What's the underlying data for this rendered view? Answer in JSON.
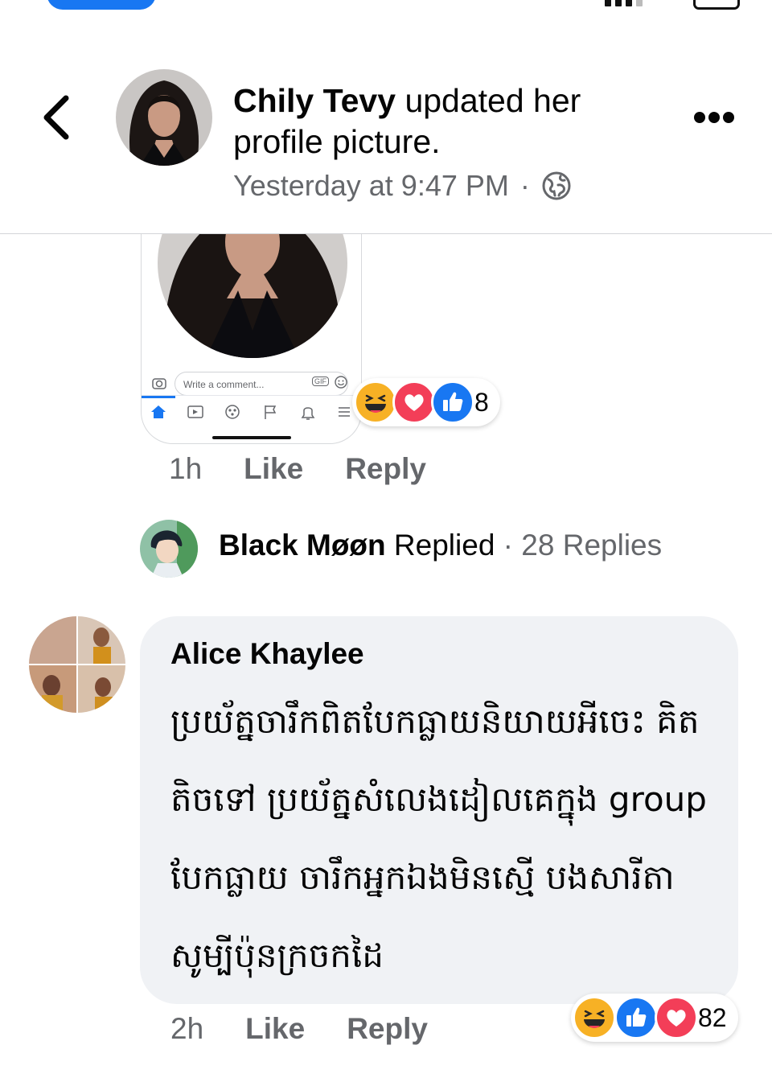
{
  "header": {
    "back_icon": "chevron-left-icon",
    "author": "Chily Tevy",
    "action": " updated her profile picture.",
    "timestamp": "Yesterday at 9:47 PM",
    "separator": "·",
    "audience_icon": "globe-icon",
    "more_icon": "more-horizontal-icon"
  },
  "embedded_screenshot": {
    "input_placeholder": "Write a comment...",
    "gif_label": "GIF"
  },
  "post_comment": {
    "reactions": [
      "haha",
      "love",
      "like"
    ],
    "reaction_count": "8",
    "time": "1h",
    "like_label": "Like",
    "reply_label": "Reply"
  },
  "replies_row": {
    "name": "Black Møøn",
    "replied_label": " Replied",
    "separator": " · ",
    "replies_count": "28 Replies"
  },
  "alice_comment": {
    "name": "Alice Khaylee",
    "text": "ប្រយ័ត្នចារឹកពិតបែកធ្លាយនិយាយអីចេះ គិតតិចទៅ ប្រយ័ត្នសំលេងដៀលគេក្នុង group បែកធ្លាយ ចារឹកអ្នកឯងមិនស្មើ បងសារីតា សូម្បីប៉ុនក្រចកដៃ",
    "reactions": [
      "haha",
      "like",
      "love"
    ],
    "reaction_count": "82",
    "time": "2h",
    "like_label": "Like",
    "reply_label": "Reply"
  },
  "colors": {
    "brand_blue": "#1877f2",
    "love_red": "#f33e58",
    "haha_yellow": "#f7b125",
    "muted_text": "#65676b",
    "bubble_bg": "#f0f2f5"
  }
}
